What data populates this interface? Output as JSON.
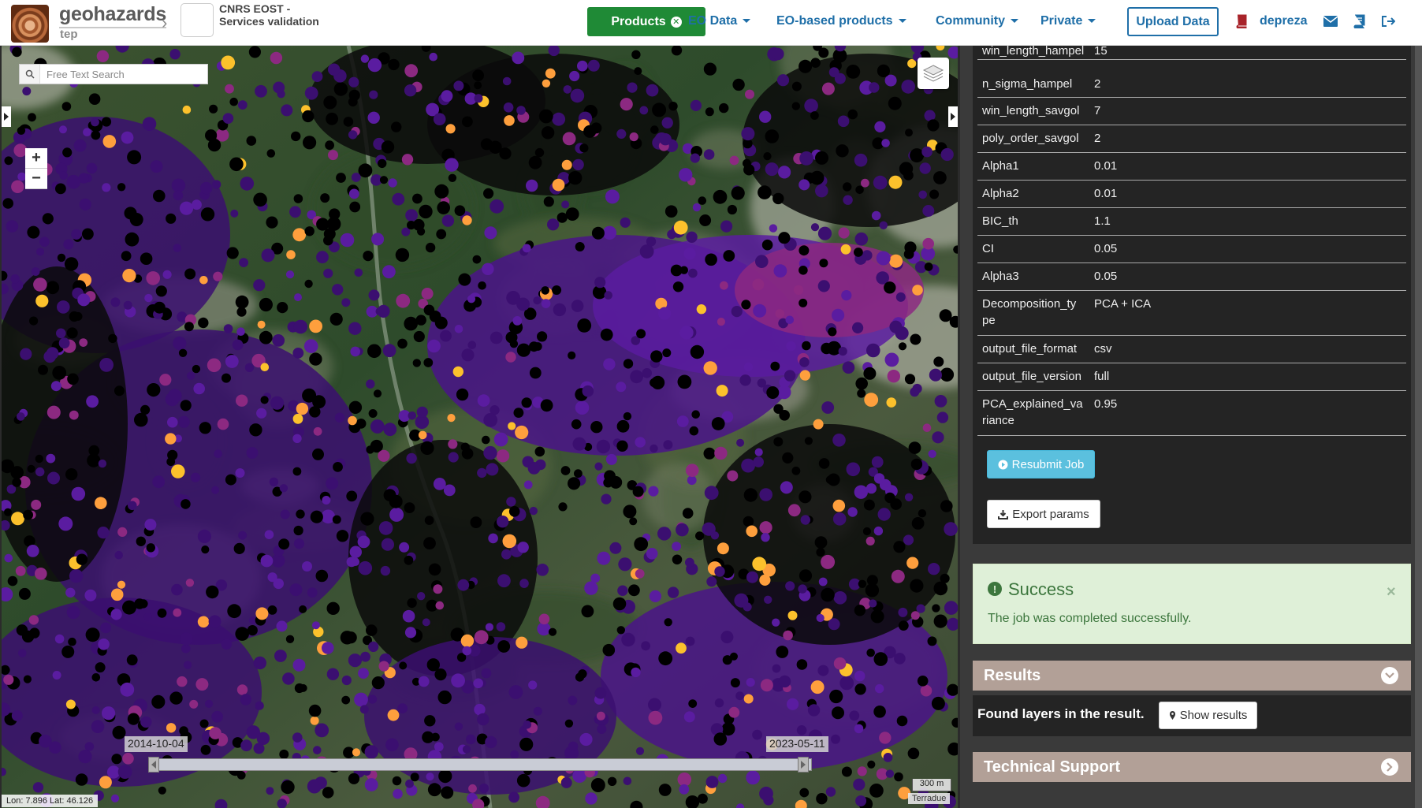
{
  "brand": {
    "name": "geohazards",
    "sub": "tep",
    "breadcrumb_title_line1": "CNRS EOST -",
    "breadcrumb_title_line2": "Services validation"
  },
  "nav": {
    "products": "Products",
    "eo_data": "EO Data",
    "eo_products": "EO-based products",
    "community": "Community",
    "private": "Private",
    "upload": "Upload Data",
    "user": "depreza",
    "icons": [
      "book-icon",
      "mail-icon",
      "docs-icon",
      "logout-icon"
    ],
    "accent_color": "#1f6fa8",
    "products_color": "#1f8a36"
  },
  "map": {
    "search_placeholder": "Free Text Search",
    "zoom_in": "+",
    "zoom_out": "−",
    "date_start": "2014-10-04",
    "date_end": "2023-05-11",
    "coords": "Lon: 7.896 Lat: 46.126",
    "scale": "300 m",
    "attribution": "Terradue",
    "point_colors": [
      "#000000",
      "#3b0f70",
      "#5a1ca0",
      "#8c2981",
      "#fe9f3d",
      "#fcc12c"
    ]
  },
  "params": [
    {
      "key": "win_length_hampel",
      "value": "15"
    },
    {
      "key": "n_sigma_hampel",
      "value": "2"
    },
    {
      "key": "win_length_savgol",
      "value": "7"
    },
    {
      "key": "poly_order_savgol",
      "value": "2"
    },
    {
      "key": "Alpha1",
      "value": "0.01"
    },
    {
      "key": "Alpha2",
      "value": "0.01"
    },
    {
      "key": "BIC_th",
      "value": "1.1"
    },
    {
      "key": "CI",
      "value": "0.05"
    },
    {
      "key": "Alpha3",
      "value": "0.05"
    },
    {
      "key": "Decomposition_ty pe",
      "value": "PCA + ICA"
    },
    {
      "key": "output_file_format",
      "value": "csv"
    },
    {
      "key": "output_file_version",
      "value": "full"
    },
    {
      "key": "PCA_explained_va riance",
      "value": "0.95"
    }
  ],
  "buttons": {
    "resubmit": "Resubmit Job",
    "export": "Export params"
  },
  "alert": {
    "title": "Success",
    "message": "The job was completed successfully.",
    "close": "×"
  },
  "results": {
    "title": "Results",
    "found": "Found layers in the result.",
    "show": "Show results"
  },
  "support": {
    "title": "Technical Support"
  }
}
